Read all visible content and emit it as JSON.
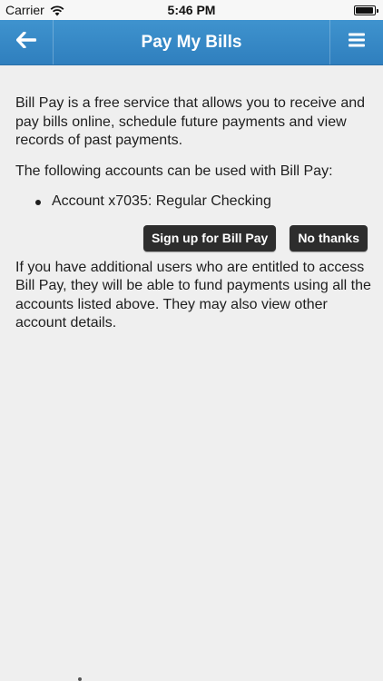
{
  "status_bar": {
    "carrier": "Carrier",
    "time": "5:46 PM",
    "wifi_icon": "wifi-icon",
    "battery_icon": "battery-icon"
  },
  "nav": {
    "title": "Pay My Bills",
    "back_icon": "back-arrow-icon",
    "menu_icon": "hamburger-menu-icon",
    "bar_color": "#3689c6"
  },
  "content": {
    "intro": "Bill Pay is a free service that allows you to receive and pay bills online, schedule future payments and view records of past payments.",
    "accounts_label": "The following accounts can be used with Bill Pay:",
    "accounts": [
      "Account x7035: Regular Checking"
    ],
    "additional_users": "If you have additional users who are entitled to access Bill Pay, they will be able to fund payments using all the accounts listed above. They may also view other account details."
  },
  "actions": {
    "sign_up_label": "Sign up for Bill Pay",
    "no_thanks_label": "No thanks",
    "button_color": "#2d2d2d"
  }
}
